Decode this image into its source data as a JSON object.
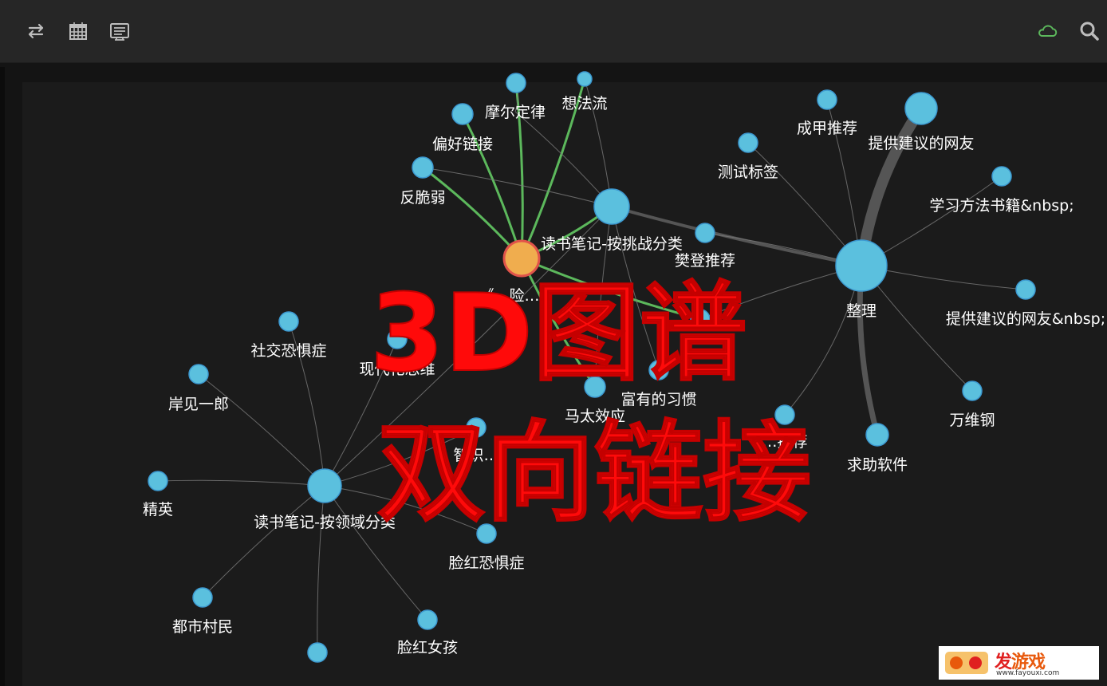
{
  "toolbar": {
    "icons": [
      "swap-arrows-icon",
      "calendar-icon",
      "list-icon",
      "cloud-icon",
      "search-icon"
    ],
    "cloud_color": "#5cb85c"
  },
  "graph": {
    "node_color": "#5bc0de",
    "node_stroke": "#3c98d0",
    "focus_color": "#f0ad4e",
    "link_color": "#7a7a7a",
    "highlight_link_color": "#5cb85c",
    "nodes": [
      {
        "id": "n_top_cut",
        "label": ""
      },
      {
        "id": "n_xfl",
        "label": "想法流"
      },
      {
        "id": "n_mefdl",
        "label": "摩尔定律"
      },
      {
        "id": "n_phlj",
        "label": "偏好链接"
      },
      {
        "id": "n_fcr",
        "label": "反脆弱"
      },
      {
        "id": "n_dsbj_tz",
        "label": "读书笔记-按挑战分类"
      },
      {
        "id": "n_focus",
        "label": "《…险…》"
      },
      {
        "id": "n_cjtj",
        "label": "成甲推荐"
      },
      {
        "id": "n_tgjy",
        "label": "提供建议的网友"
      },
      {
        "id": "n_csbq",
        "label": "测试标签"
      },
      {
        "id": "n_xxff",
        "label": "学习方法书籍&nbsp;"
      },
      {
        "id": "n_fdtj",
        "label": "樊登推荐"
      },
      {
        "id": "n_zl",
        "label": "整理"
      },
      {
        "id": "n_tgjy2",
        "label": "提供建议的网友&nbsp;"
      },
      {
        "id": "n_mid_hidden",
        "label": "…"
      },
      {
        "id": "n_fydxg",
        "label": "富有的习惯"
      },
      {
        "id": "n_wwg",
        "label": "万维钢"
      },
      {
        "id": "n_mtxy",
        "label": "马太效应"
      },
      {
        "id": "n_ms_tj",
        "label": "…推荐"
      },
      {
        "id": "n_qzrj",
        "label": "求助软件"
      },
      {
        "id": "n_sjkjz",
        "label": "社交恐惧症"
      },
      {
        "id": "n_xdhsw",
        "label": "现代化思维"
      },
      {
        "id": "n_ajyl",
        "label": "岸见一郎"
      },
      {
        "id": "n_zsgl",
        "label": "智识…"
      },
      {
        "id": "n_jy",
        "label": "精英"
      },
      {
        "id": "n_dsbj_ly",
        "label": "读书笔记-按领域分类"
      },
      {
        "id": "n_lhkjz",
        "label": "脸红恐惧症"
      },
      {
        "id": "n_dscm",
        "label": "都市村民"
      },
      {
        "id": "n_lhnh",
        "label": "脸红女孩"
      },
      {
        "id": "n_bottom",
        "label": ""
      }
    ],
    "links": [
      [
        "n_focus",
        "n_top_cut"
      ],
      [
        "n_focus",
        "n_xfl"
      ],
      [
        "n_focus",
        "n_phlj"
      ],
      [
        "n_focus",
        "n_fcr"
      ],
      [
        "n_focus",
        "n_dsbj_tz"
      ],
      [
        "n_focus",
        "n_mid_hidden"
      ],
      [
        "n_focus",
        "n_mtxy"
      ],
      [
        "n_dsbj_tz",
        "n_xfl"
      ],
      [
        "n_dsbj_tz",
        "n_mefdl"
      ],
      [
        "n_dsbj_tz",
        "n_fcr"
      ],
      [
        "n_dsbj_tz",
        "n_zl"
      ],
      [
        "n_dsbj_tz",
        "n_mtxy"
      ],
      [
        "n_dsbj_tz",
        "n_fydxg"
      ],
      [
        "n_mefdl",
        "n_top_cut"
      ],
      [
        "n_zl",
        "n_cjtj"
      ],
      [
        "n_zl",
        "n_tgjy"
      ],
      [
        "n_zl",
        "n_csbq"
      ],
      [
        "n_zl",
        "n_xxff"
      ],
      [
        "n_zl",
        "n_fdtj"
      ],
      [
        "n_zl",
        "n_tgjy2"
      ],
      [
        "n_zl",
        "n_wwg"
      ],
      [
        "n_zl",
        "n_qzrj"
      ],
      [
        "n_zl",
        "n_ms_tj"
      ],
      [
        "n_zl",
        "n_mid_hidden"
      ],
      [
        "n_dsbj_ly",
        "n_sjkjz"
      ],
      [
        "n_dsbj_ly",
        "n_xdhsw"
      ],
      [
        "n_dsbj_ly",
        "n_ajyl"
      ],
      [
        "n_dsbj_ly",
        "n_zsgl"
      ],
      [
        "n_dsbj_ly",
        "n_jy"
      ],
      [
        "n_dsbj_ly",
        "n_lhkjz"
      ],
      [
        "n_dsbj_ly",
        "n_dscm"
      ],
      [
        "n_dsbj_ly",
        "n_lhnh"
      ],
      [
        "n_dsbj_ly",
        "n_bottom"
      ],
      [
        "n_dsbj_ly",
        "n_dsbj_tz"
      ]
    ]
  },
  "overlay": {
    "line1": "3D图谱",
    "line2": "双向链接",
    "color": "#ff0a0a"
  },
  "watermark": {
    "title_a": "发",
    "title_b": "游戏",
    "url": "www.fayouxi.com"
  }
}
